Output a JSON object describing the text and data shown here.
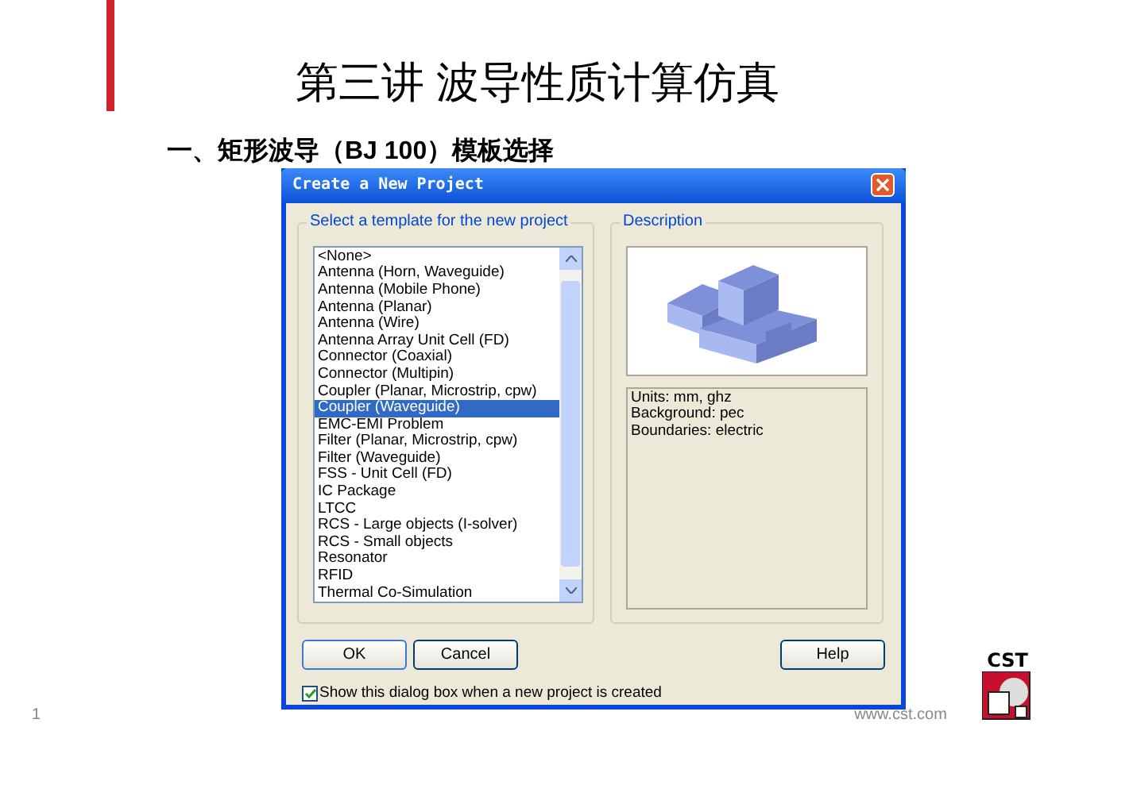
{
  "slide": {
    "title": "第三讲 波导性质计算仿真",
    "subtitle": "一、矩形波导（BJ 100）模板选择",
    "page_number": "1",
    "footer_url": "www.cst.com",
    "logo_text": "CST"
  },
  "dialog": {
    "title": "Create a New Project",
    "template_group": "Select a template for the new project",
    "templates": [
      {
        "label": "<None>",
        "selected": false
      },
      {
        "label": "Antenna (Horn, Waveguide)",
        "selected": false
      },
      {
        "label": "Antenna (Mobile Phone)",
        "selected": false
      },
      {
        "label": "Antenna (Planar)",
        "selected": false
      },
      {
        "label": "Antenna (Wire)",
        "selected": false
      },
      {
        "label": "Antenna Array Unit Cell (FD)",
        "selected": false
      },
      {
        "label": "Connector (Coaxial)",
        "selected": false
      },
      {
        "label": "Connector (Multipin)",
        "selected": false
      },
      {
        "label": "Coupler (Planar, Microstrip, cpw)",
        "selected": false
      },
      {
        "label": "Coupler (Waveguide)",
        "selected": true
      },
      {
        "label": "EMC-EMI Problem",
        "selected": false
      },
      {
        "label": "Filter (Planar, Microstrip, cpw)",
        "selected": false
      },
      {
        "label": "Filter (Waveguide)",
        "selected": false
      },
      {
        "label": "FSS - Unit Cell (FD)",
        "selected": false
      },
      {
        "label": "IC Package",
        "selected": false
      },
      {
        "label": "LTCC",
        "selected": false
      },
      {
        "label": "RCS - Large objects (I-solver)",
        "selected": false
      },
      {
        "label": "RCS - Small objects",
        "selected": false
      },
      {
        "label": "Resonator",
        "selected": false
      },
      {
        "label": "RFID",
        "selected": false
      },
      {
        "label": "Thermal Co-Simulation",
        "selected": false
      }
    ],
    "description_group": "Description",
    "description": [
      "Units: mm, ghz",
      "Background: pec",
      "Boundaries: electric"
    ],
    "buttons": [
      "OK",
      "Cancel",
      "Help"
    ],
    "checkbox": {
      "label": "Show this dialog box when a new project is created",
      "checked": true
    }
  }
}
